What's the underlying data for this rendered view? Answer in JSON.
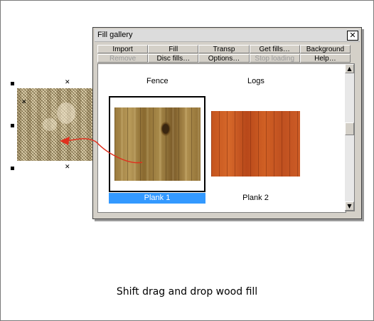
{
  "window": {
    "title": "Fill gallery",
    "close_label": "✕"
  },
  "toolbar": {
    "row1": [
      "Import",
      "Fill",
      "Transp",
      "Get fills…",
      "Background"
    ],
    "row2": [
      "Remove",
      "Disc fills…",
      "Options…",
      "Stop loading",
      "Help…"
    ],
    "disabled": [
      "Remove",
      "Stop loading"
    ]
  },
  "gallery": {
    "folders": [
      "Fence",
      "Logs"
    ],
    "items": [
      {
        "name": "Plank 1",
        "selected": true,
        "color": "#a88a4a"
      },
      {
        "name": "Plank 2",
        "selected": false,
        "color": "#c4541e"
      }
    ],
    "selection_color": "#3399ff"
  },
  "caption": "Shift drag and drop wood fill",
  "colors": {
    "arrow": "#e0301e"
  }
}
